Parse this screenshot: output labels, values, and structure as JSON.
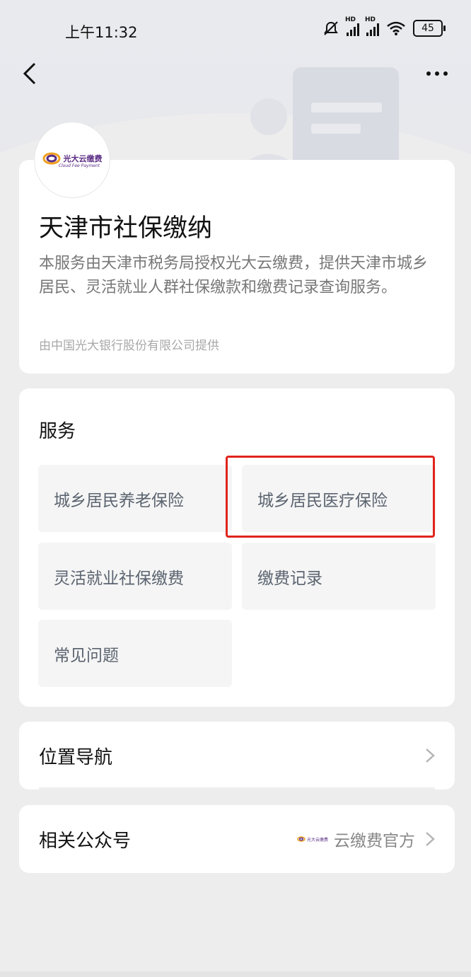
{
  "status_bar": {
    "time": "上午11:32",
    "battery": "45",
    "network_label": "HD"
  },
  "header": {
    "logo_text": "光大云缴费",
    "logo_subtext": "Cloud Fee Payment",
    "title": "天津市社保缴纳",
    "description": "本服务由天津市税务局授权光大云缴费，提供天津市城乡居民、灵活就业人群社保缴款和缴费记录查询服务。",
    "provider": "由中国光大银行股份有限公司提供"
  },
  "services": {
    "title": "服务",
    "items": [
      {
        "label": "城乡居民养老保险"
      },
      {
        "label": "城乡居民医疗保险"
      },
      {
        "label": "灵活就业社保缴费"
      },
      {
        "label": "缴费记录"
      },
      {
        "label": "常见问题"
      }
    ],
    "highlighted_index": 1
  },
  "location": {
    "label": "位置导航"
  },
  "official_account": {
    "label": "相关公众号",
    "name": "云缴费官方",
    "mini_logo_text": "光大云缴费"
  },
  "icons": {
    "back": "chevron-left-icon",
    "more": "more-dots-icon",
    "chevron": "chevron-right-icon",
    "mute": "bell-off-icon",
    "wifi": "wifi-icon",
    "signal": "signal-icon",
    "battery": "battery-icon"
  },
  "colors": {
    "highlight_border": "#e0241c",
    "brand_purple": "#5a2c84",
    "brand_orange": "#f0a020"
  }
}
